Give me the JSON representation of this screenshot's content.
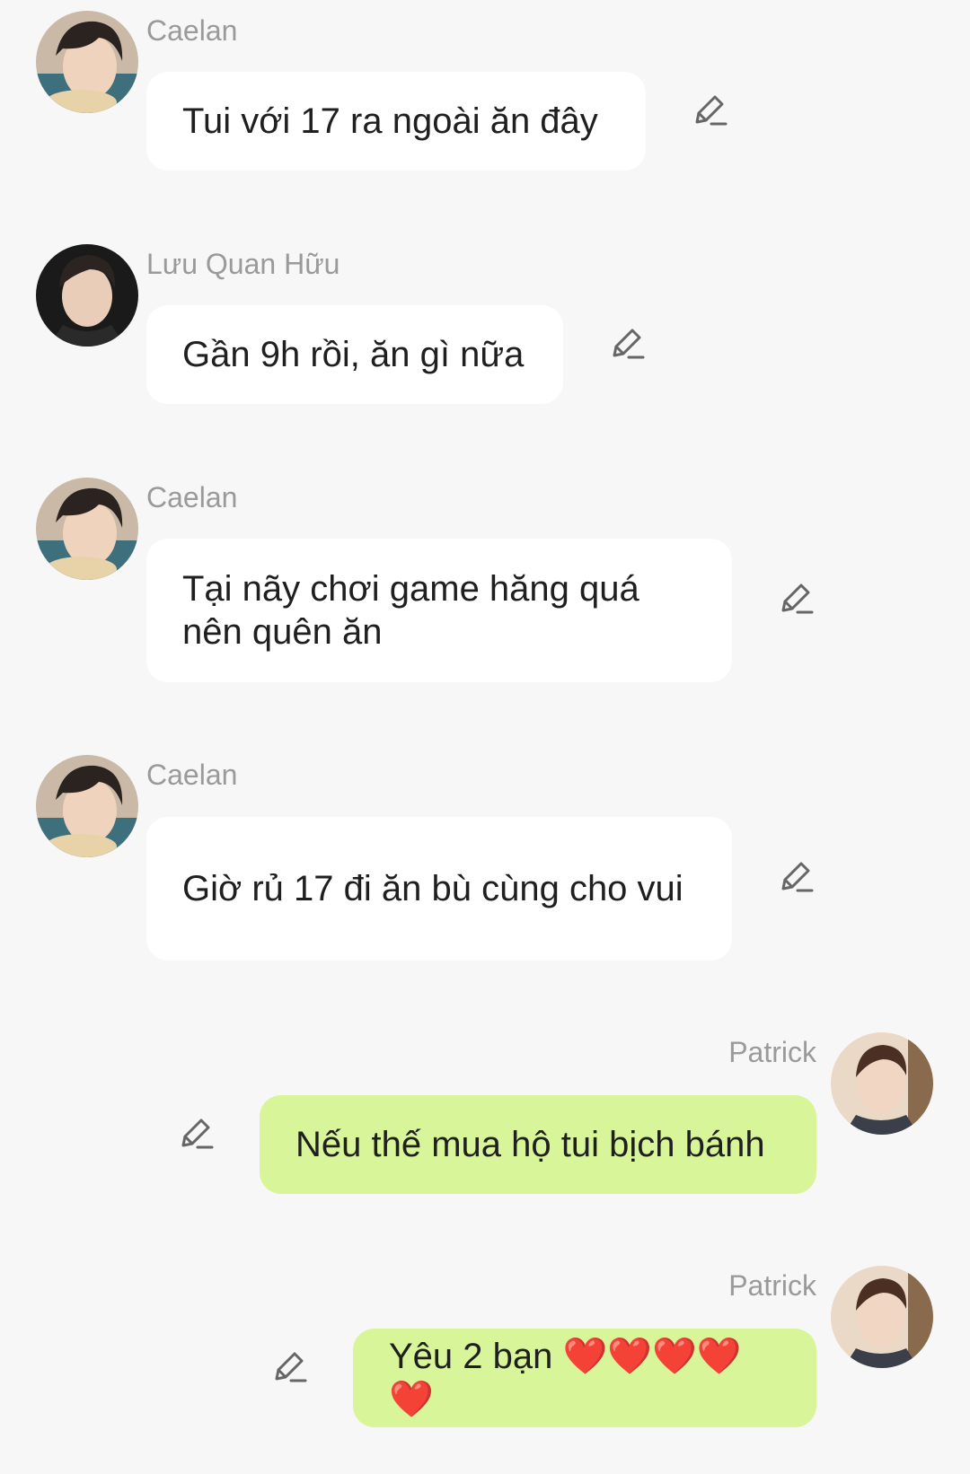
{
  "messages": [
    {
      "sender": "Caelan",
      "text": "Tui với 17 ra ngoài ăn đây",
      "side": "left",
      "edit_icon": "pencil-edit-icon"
    },
    {
      "sender": "Lưu Quan Hữu",
      "text": "Gần 9h rồi, ăn gì nữa",
      "side": "left",
      "edit_icon": "pencil-edit-icon"
    },
    {
      "sender": "Caelan",
      "text": "Tại nãy chơi game hăng quá nên quên ăn",
      "side": "left",
      "edit_icon": "pencil-edit-icon"
    },
    {
      "sender": "Caelan",
      "text": "Giờ rủ 17 đi ăn bù cùng cho vui",
      "side": "left",
      "edit_icon": "pencil-edit-icon"
    },
    {
      "sender": "Patrick",
      "text": "Nếu thế mua hộ tui bịch bánh",
      "side": "right",
      "edit_icon": "pencil-edit-icon"
    },
    {
      "sender": "Patrick",
      "text": "Yêu 2 bạn ❤️❤️❤️❤️❤️",
      "side": "right",
      "edit_icon": "pencil-edit-icon"
    }
  ],
  "colors": {
    "background": "#f7f7f7",
    "incoming_bubble": "#ffffff",
    "outgoing_bubble": "#d9f59a",
    "sender_name": "#9a9a9a",
    "message_text": "#1f1f1f"
  }
}
